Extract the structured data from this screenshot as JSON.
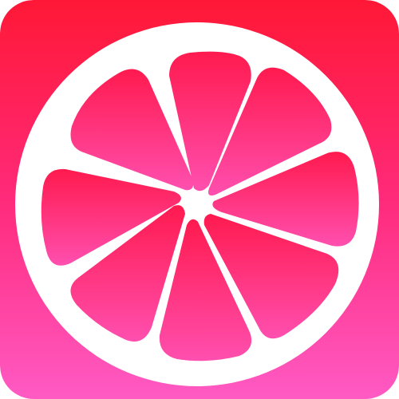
{
  "icon": {
    "name": "grapefruit-slice-icon",
    "colors": {
      "background_top": "#FF1836",
      "background_bottom": "#FF5AC4",
      "rind": "#FFFFFF",
      "segment_top": "#FF1A4E",
      "segment_bottom": "#FF4FAF"
    }
  }
}
